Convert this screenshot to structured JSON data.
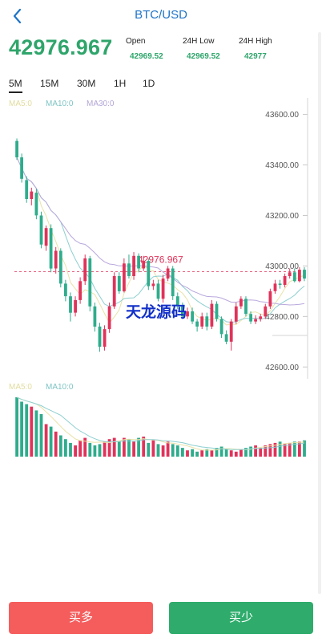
{
  "header": {
    "title": "BTC/USD",
    "back_icon": "chevron-left-icon"
  },
  "ticker": {
    "price": "42976.967",
    "open_label": "Open",
    "open_value": "42969.52",
    "low_label": "24H Low",
    "low_value": "42969.52",
    "high_label": "24H High",
    "high_value": "42977"
  },
  "tabs": [
    {
      "label": "5M",
      "active": true
    },
    {
      "label": "15M",
      "active": false
    },
    {
      "label": "30M",
      "active": false
    },
    {
      "label": "1H",
      "active": false
    },
    {
      "label": "1D",
      "active": false
    }
  ],
  "legend": {
    "ma5": "MA5:0",
    "ma10": "MA10:0",
    "ma30": "MA30:0",
    "vol_ma5": "MA5:0",
    "vol_ma10": "MA10:0"
  },
  "colors": {
    "up": "#2fac8c",
    "down": "#e0335a",
    "ma5": "#e9e2a8",
    "ma10": "#8ecfd0",
    "ma30": "#b9a8dd",
    "brand_blue": "#1f74c8",
    "price_green": "#2fa56b",
    "buy_long": "#f55d5d",
    "buy_short": "#2fac6c"
  },
  "watermark": "天龙源码",
  "chart_data": {
    "type": "candlestick",
    "y_ticks": [
      "43600.00",
      "43400.00",
      "43200.00",
      "43000.00",
      "42800.00",
      "42600.00"
    ],
    "y_tick_values": [
      43600,
      43400,
      43200,
      43000,
      42800,
      42600
    ],
    "ylim": [
      42585,
      43640
    ],
    "current_price_label": "42976.967",
    "current_price": 42976.967,
    "candles": [
      [
        43495,
        43430,
        43505,
        43420
      ],
      [
        43430,
        43345,
        43445,
        43330
      ],
      [
        43340,
        43265,
        43355,
        43250
      ],
      [
        43265,
        43295,
        43310,
        43240
      ],
      [
        43290,
        43200,
        43305,
        43185
      ],
      [
        43200,
        43085,
        43215,
        43070
      ],
      [
        43080,
        43150,
        43160,
        43060
      ],
      [
        43150,
        42990,
        43165,
        42975
      ],
      [
        42990,
        43060,
        43075,
        42970
      ],
      [
        43060,
        42930,
        43070,
        42915
      ],
      [
        42930,
        42880,
        42945,
        42860
      ],
      [
        42880,
        42815,
        42895,
        42780
      ],
      [
        42815,
        42865,
        42880,
        42800
      ],
      [
        42865,
        42940,
        42955,
        42850
      ],
      [
        42940,
        43030,
        43045,
        42925
      ],
      [
        43030,
        42840,
        43040,
        42820
      ],
      [
        42840,
        42760,
        42855,
        42740
      ],
      [
        42760,
        42680,
        42775,
        42660
      ],
      [
        42680,
        42750,
        42765,
        42665
      ],
      [
        42750,
        42840,
        42855,
        42735
      ],
      [
        42840,
        42960,
        42975,
        42830
      ],
      [
        42960,
        42900,
        42975,
        42890
      ],
      [
        42900,
        43010,
        43030,
        42895
      ],
      [
        43010,
        42960,
        43045,
        42950
      ],
      [
        42960,
        43040,
        43055,
        42945
      ],
      [
        43040,
        42990,
        43050,
        42975
      ],
      [
        42990,
        43020,
        43040,
        42980
      ],
      [
        43020,
        42920,
        43030,
        42905
      ],
      [
        42920,
        42930,
        42945,
        42905
      ],
      [
        42930,
        42870,
        42945,
        42860
      ],
      [
        42870,
        42950,
        42965,
        42855
      ],
      [
        42950,
        42990,
        43000,
        42940
      ],
      [
        42990,
        42880,
        43000,
        42865
      ],
      [
        42880,
        42840,
        42895,
        42830
      ],
      [
        42840,
        42800,
        42855,
        42790
      ],
      [
        42800,
        42820,
        42835,
        42790
      ],
      [
        42820,
        42780,
        42835,
        42770
      ],
      [
        42780,
        42760,
        42790,
        42740
      ],
      [
        42760,
        42800,
        42815,
        42750
      ],
      [
        42800,
        42760,
        42815,
        42745
      ],
      [
        42760,
        42850,
        42865,
        42750
      ],
      [
        42850,
        42790,
        42860,
        42780
      ],
      [
        42790,
        42730,
        42800,
        42715
      ],
      [
        42730,
        42700,
        42745,
        42690
      ],
      [
        42700,
        42780,
        42790,
        42665
      ],
      [
        42780,
        42840,
        42855,
        42770
      ],
      [
        42840,
        42870,
        42880,
        42830
      ],
      [
        42870,
        42810,
        42880,
        42800
      ],
      [
        42810,
        42780,
        42820,
        42770
      ],
      [
        42780,
        42790,
        42805,
        42770
      ],
      [
        42790,
        42800,
        42810,
        42780
      ],
      [
        42800,
        42840,
        42850,
        42790
      ],
      [
        42840,
        42900,
        42910,
        42830
      ],
      [
        42900,
        42930,
        42945,
        42890
      ],
      [
        42930,
        42925,
        42945,
        42910
      ],
      [
        42925,
        42960,
        42970,
        42915
      ],
      [
        42960,
        42975,
        42990,
        42950
      ],
      [
        42975,
        42940,
        42990,
        42935
      ],
      [
        42940,
        42985,
        42995,
        42935
      ],
      [
        42985,
        42950,
        42995,
        42940
      ]
    ],
    "volume": [
      95,
      88,
      84,
      80,
      74,
      68,
      52,
      48,
      40,
      34,
      28,
      22,
      18,
      26,
      30,
      22,
      18,
      20,
      24,
      28,
      30,
      24,
      30,
      28,
      24,
      30,
      32,
      22,
      26,
      20,
      18,
      24,
      20,
      18,
      14,
      10,
      12,
      8,
      10,
      12,
      10,
      14,
      16,
      12,
      10,
      8,
      12,
      14,
      16,
      18,
      14,
      18,
      20,
      22,
      24,
      20,
      22,
      24,
      24,
      26
    ],
    "volume_up": [
      false,
      false,
      false,
      true,
      false,
      false,
      true,
      false,
      true,
      false,
      false,
      false,
      true,
      true,
      true,
      false,
      false,
      false,
      true,
      true,
      true,
      false,
      true,
      false,
      true,
      false,
      true,
      false,
      true,
      false,
      true,
      true,
      false,
      false,
      false,
      true,
      false,
      false,
      true,
      false,
      true,
      false,
      false,
      false,
      true,
      true,
      true,
      false,
      false,
      true,
      true,
      true,
      true,
      true,
      false,
      true,
      true,
      false,
      true,
      false
    ]
  },
  "footer": {
    "buy_long": "买多",
    "buy_short": "买少"
  }
}
